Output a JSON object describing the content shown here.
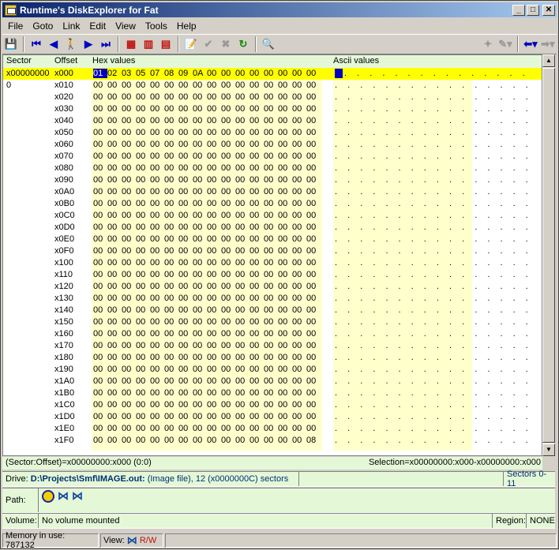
{
  "window": {
    "title": "Runtime's DiskExplorer for Fat"
  },
  "menu": [
    "File",
    "Goto",
    "Link",
    "Edit",
    "View",
    "Tools",
    "Help"
  ],
  "hex": {
    "headers": {
      "sector": "Sector",
      "offset": "Offset",
      "hex": "Hex values",
      "ascii": "Ascii values"
    },
    "sector_value": "x00000000",
    "sector_sub": "0",
    "rows": [
      {
        "offset": "x000",
        "bytes": [
          "01",
          "02",
          "03",
          "05",
          "07",
          "08",
          "09",
          "0A",
          "00",
          "00",
          "00",
          "00",
          "00",
          "00",
          "00",
          "00"
        ],
        "ascii": ". . . . . . . . . . . . . . ."
      },
      {
        "offset": "x010",
        "bytes": [
          "00",
          "00",
          "00",
          "00",
          "00",
          "00",
          "00",
          "00",
          "00",
          "00",
          "00",
          "00",
          "00",
          "00",
          "00",
          "00"
        ],
        "ascii": ". . . . . . . . . . . . . . . ."
      },
      {
        "offset": "x020",
        "bytes": [
          "00",
          "00",
          "00",
          "00",
          "00",
          "00",
          "00",
          "00",
          "00",
          "00",
          "00",
          "00",
          "00",
          "00",
          "00",
          "00"
        ],
        "ascii": ". . . . . . . . . . . . . . . ."
      },
      {
        "offset": "x030",
        "bytes": [
          "00",
          "00",
          "00",
          "00",
          "00",
          "00",
          "00",
          "00",
          "00",
          "00",
          "00",
          "00",
          "00",
          "00",
          "00",
          "00"
        ],
        "ascii": ". . . . . . . . . . . . . . . ."
      },
      {
        "offset": "x040",
        "bytes": [
          "00",
          "00",
          "00",
          "00",
          "00",
          "00",
          "00",
          "00",
          "00",
          "00",
          "00",
          "00",
          "00",
          "00",
          "00",
          "00"
        ],
        "ascii": ". . . . . . . . . . . . . . . ."
      },
      {
        "offset": "x050",
        "bytes": [
          "00",
          "00",
          "00",
          "00",
          "00",
          "00",
          "00",
          "00",
          "00",
          "00",
          "00",
          "00",
          "00",
          "00",
          "00",
          "00"
        ],
        "ascii": ". . . . . . . . . . . . . . . ."
      },
      {
        "offset": "x060",
        "bytes": [
          "00",
          "00",
          "00",
          "00",
          "00",
          "00",
          "00",
          "00",
          "00",
          "00",
          "00",
          "00",
          "00",
          "00",
          "00",
          "00"
        ],
        "ascii": ". . . . . . . . . . . . . . . ."
      },
      {
        "offset": "x070",
        "bytes": [
          "00",
          "00",
          "00",
          "00",
          "00",
          "00",
          "00",
          "00",
          "00",
          "00",
          "00",
          "00",
          "00",
          "00",
          "00",
          "00"
        ],
        "ascii": ". . . . . . . . . . . . . . . ."
      },
      {
        "offset": "x080",
        "bytes": [
          "00",
          "00",
          "00",
          "00",
          "00",
          "00",
          "00",
          "00",
          "00",
          "00",
          "00",
          "00",
          "00",
          "00",
          "00",
          "00"
        ],
        "ascii": ". . . . . . . . . . . . . . . ."
      },
      {
        "offset": "x090",
        "bytes": [
          "00",
          "00",
          "00",
          "00",
          "00",
          "00",
          "00",
          "00",
          "00",
          "00",
          "00",
          "00",
          "00",
          "00",
          "00",
          "00"
        ],
        "ascii": ". . . . . . . . . . . . . . . ."
      },
      {
        "offset": "x0A0",
        "bytes": [
          "00",
          "00",
          "00",
          "00",
          "00",
          "00",
          "00",
          "00",
          "00",
          "00",
          "00",
          "00",
          "00",
          "00",
          "00",
          "00"
        ],
        "ascii": ". . . . . . . . . . . . . . . ."
      },
      {
        "offset": "x0B0",
        "bytes": [
          "00",
          "00",
          "00",
          "00",
          "00",
          "00",
          "00",
          "00",
          "00",
          "00",
          "00",
          "00",
          "00",
          "00",
          "00",
          "00"
        ],
        "ascii": ". . . . . . . . . . . . . . . ."
      },
      {
        "offset": "x0C0",
        "bytes": [
          "00",
          "00",
          "00",
          "00",
          "00",
          "00",
          "00",
          "00",
          "00",
          "00",
          "00",
          "00",
          "00",
          "00",
          "00",
          "00"
        ],
        "ascii": ". . . . . . . . . . . . . . . ."
      },
      {
        "offset": "x0D0",
        "bytes": [
          "00",
          "00",
          "00",
          "00",
          "00",
          "00",
          "00",
          "00",
          "00",
          "00",
          "00",
          "00",
          "00",
          "00",
          "00",
          "00"
        ],
        "ascii": ". . . . . . . . . . . . . . . ."
      },
      {
        "offset": "x0E0",
        "bytes": [
          "00",
          "00",
          "00",
          "00",
          "00",
          "00",
          "00",
          "00",
          "00",
          "00",
          "00",
          "00",
          "00",
          "00",
          "00",
          "00"
        ],
        "ascii": ". . . . . . . . . . . . . . . ."
      },
      {
        "offset": "x0F0",
        "bytes": [
          "00",
          "00",
          "00",
          "00",
          "00",
          "00",
          "00",
          "00",
          "00",
          "00",
          "00",
          "00",
          "00",
          "00",
          "00",
          "00"
        ],
        "ascii": ". . . . . . . . . . . . . . . ."
      },
      {
        "offset": "x100",
        "bytes": [
          "00",
          "00",
          "00",
          "00",
          "00",
          "00",
          "00",
          "00",
          "00",
          "00",
          "00",
          "00",
          "00",
          "00",
          "00",
          "00"
        ],
        "ascii": ". . . . . . . . . . . . . . . ."
      },
      {
        "offset": "x110",
        "bytes": [
          "00",
          "00",
          "00",
          "00",
          "00",
          "00",
          "00",
          "00",
          "00",
          "00",
          "00",
          "00",
          "00",
          "00",
          "00",
          "00"
        ],
        "ascii": ". . . . . . . . . . . . . . . ."
      },
      {
        "offset": "x120",
        "bytes": [
          "00",
          "00",
          "00",
          "00",
          "00",
          "00",
          "00",
          "00",
          "00",
          "00",
          "00",
          "00",
          "00",
          "00",
          "00",
          "00"
        ],
        "ascii": ". . . . . . . . . . . . . . . ."
      },
      {
        "offset": "x130",
        "bytes": [
          "00",
          "00",
          "00",
          "00",
          "00",
          "00",
          "00",
          "00",
          "00",
          "00",
          "00",
          "00",
          "00",
          "00",
          "00",
          "00"
        ],
        "ascii": ". . . . . . . . . . . . . . . ."
      },
      {
        "offset": "x140",
        "bytes": [
          "00",
          "00",
          "00",
          "00",
          "00",
          "00",
          "00",
          "00",
          "00",
          "00",
          "00",
          "00",
          "00",
          "00",
          "00",
          "00"
        ],
        "ascii": ". . . . . . . . . . . . . . . ."
      },
      {
        "offset": "x150",
        "bytes": [
          "00",
          "00",
          "00",
          "00",
          "00",
          "00",
          "00",
          "00",
          "00",
          "00",
          "00",
          "00",
          "00",
          "00",
          "00",
          "00"
        ],
        "ascii": ". . . . . . . . . . . . . . . ."
      },
      {
        "offset": "x160",
        "bytes": [
          "00",
          "00",
          "00",
          "00",
          "00",
          "00",
          "00",
          "00",
          "00",
          "00",
          "00",
          "00",
          "00",
          "00",
          "00",
          "00"
        ],
        "ascii": ". . . . . . . . . . . . . . . ."
      },
      {
        "offset": "x170",
        "bytes": [
          "00",
          "00",
          "00",
          "00",
          "00",
          "00",
          "00",
          "00",
          "00",
          "00",
          "00",
          "00",
          "00",
          "00",
          "00",
          "00"
        ],
        "ascii": ". . . . . . . . . . . . . . . ."
      },
      {
        "offset": "x180",
        "bytes": [
          "00",
          "00",
          "00",
          "00",
          "00",
          "00",
          "00",
          "00",
          "00",
          "00",
          "00",
          "00",
          "00",
          "00",
          "00",
          "00"
        ],
        "ascii": ". . . . . . . . . . . . . . . ."
      },
      {
        "offset": "x190",
        "bytes": [
          "00",
          "00",
          "00",
          "00",
          "00",
          "00",
          "00",
          "00",
          "00",
          "00",
          "00",
          "00",
          "00",
          "00",
          "00",
          "00"
        ],
        "ascii": ". . . . . . . . . . . . . . . ."
      },
      {
        "offset": "x1A0",
        "bytes": [
          "00",
          "00",
          "00",
          "00",
          "00",
          "00",
          "00",
          "00",
          "00",
          "00",
          "00",
          "00",
          "00",
          "00",
          "00",
          "00"
        ],
        "ascii": ". . . . . . . . . . . . . . . ."
      },
      {
        "offset": "x1B0",
        "bytes": [
          "00",
          "00",
          "00",
          "00",
          "00",
          "00",
          "00",
          "00",
          "00",
          "00",
          "00",
          "00",
          "00",
          "00",
          "00",
          "00"
        ],
        "ascii": ". . . . . . . . . . . . . . . ."
      },
      {
        "offset": "x1C0",
        "bytes": [
          "00",
          "00",
          "00",
          "00",
          "00",
          "00",
          "00",
          "00",
          "00",
          "00",
          "00",
          "00",
          "00",
          "00",
          "00",
          "00"
        ],
        "ascii": ". . . . . . . . . . . . . . . ."
      },
      {
        "offset": "x1D0",
        "bytes": [
          "00",
          "00",
          "00",
          "00",
          "00",
          "00",
          "00",
          "00",
          "00",
          "00",
          "00",
          "00",
          "00",
          "00",
          "00",
          "00"
        ],
        "ascii": ". . . . . . . . . . . . . . . ."
      },
      {
        "offset": "x1E0",
        "bytes": [
          "00",
          "00",
          "00",
          "00",
          "00",
          "00",
          "00",
          "00",
          "00",
          "00",
          "00",
          "00",
          "00",
          "00",
          "00",
          "00"
        ],
        "ascii": ". . . . . . . . . . . . . . . ."
      },
      {
        "offset": "x1F0",
        "bytes": [
          "00",
          "00",
          "00",
          "00",
          "00",
          "00",
          "00",
          "00",
          "00",
          "00",
          "00",
          "00",
          "00",
          "00",
          "00",
          "08"
        ],
        "ascii": ". . . . . . . . . . . . . . . ."
      }
    ]
  },
  "position": {
    "left": "(Sector:Offset)=x00000000:x000 (0:0)",
    "right": "Selection=x00000000:x000-x00000000:x000"
  },
  "drive": {
    "label": "Drive:",
    "path": "D:\\Projects\\Smf\\IMAGE.out:",
    "desc": "(Image file), 12 (x0000000C) sectors",
    "sectors": "Sectors 0-11"
  },
  "path": {
    "label": "Path:"
  },
  "volume": {
    "label": "Volume:",
    "value": "No volume mounted",
    "region_label": "Region:",
    "region_value": "NONE"
  },
  "status": {
    "memory": "Memory in use: 787132",
    "view_label": "View:",
    "rw": "R/W"
  }
}
